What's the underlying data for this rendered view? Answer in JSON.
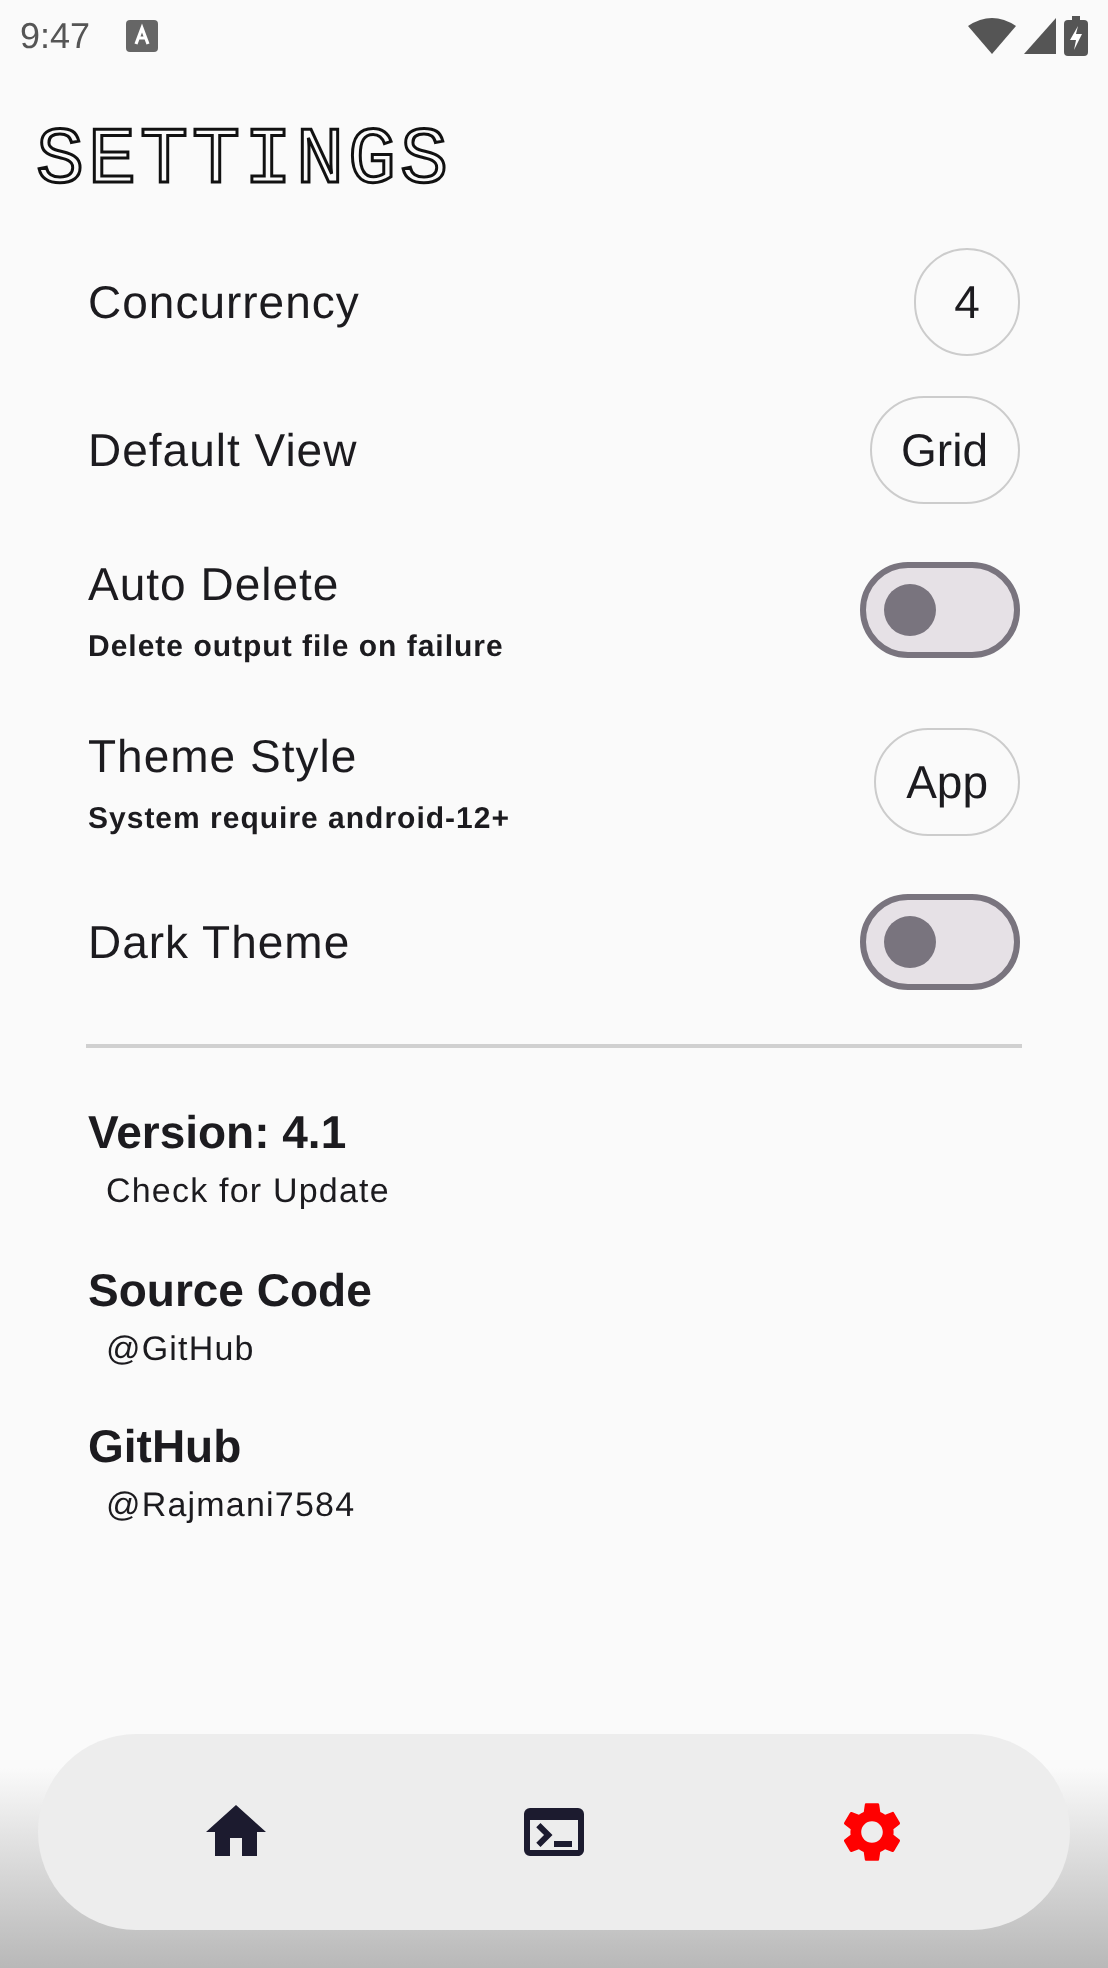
{
  "status_bar": {
    "time": "9:47"
  },
  "title": "SETTINGS",
  "settings": [
    {
      "kind": "chip",
      "label": "Concurrency",
      "value": "4"
    },
    {
      "kind": "chip",
      "label": "Default View",
      "value": "Grid"
    },
    {
      "kind": "toggle",
      "label": "Auto Delete",
      "description": "Delete output file on failure",
      "on": false
    },
    {
      "kind": "chip",
      "label": "Theme Style",
      "description": "System require android-12+",
      "value": "App"
    },
    {
      "kind": "toggle",
      "label": "Dark Theme",
      "on": false
    }
  ],
  "about": [
    {
      "title": "Version: 4.1",
      "link": "Check for Update"
    },
    {
      "title": "Source Code",
      "link": "@GitHub"
    },
    {
      "title": "GitHub",
      "link": "@Rajmani7584"
    }
  ],
  "nav": [
    {
      "kind": "home",
      "selected": false
    },
    {
      "kind": "terminal",
      "selected": false
    },
    {
      "kind": "settings",
      "selected": true
    }
  ]
}
